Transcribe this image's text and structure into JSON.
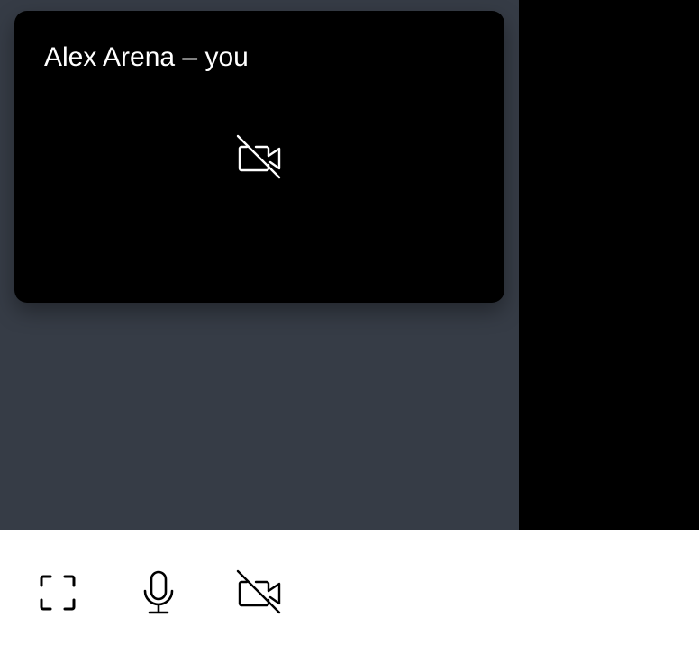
{
  "self_tile": {
    "name_label": "Alex Arena – you",
    "camera_status_icon": "camera-off-icon"
  },
  "toolbar": {
    "buttons": [
      {
        "icon": "fullscreen-icon"
      },
      {
        "icon": "microphone-icon"
      },
      {
        "icon": "camera-off-icon"
      }
    ]
  },
  "colors": {
    "panel_background": "#363c46",
    "video_background": "#000000",
    "toolbar_background": "#ffffff",
    "tile_text": "#ffffff",
    "toolbar_icon": "#000000"
  }
}
